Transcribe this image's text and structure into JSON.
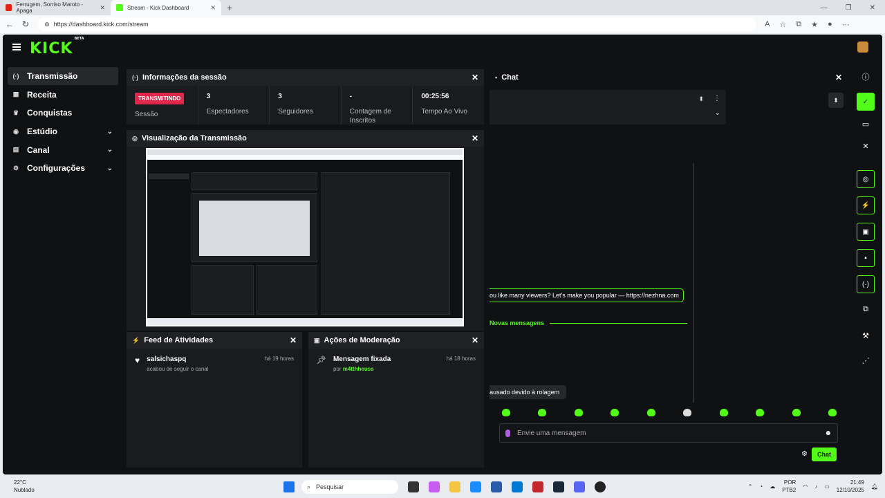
{
  "browser": {
    "tabs": [
      {
        "title": "Ferrugem, Sorriso Maroto - Apaga",
        "color": "#e62117"
      },
      {
        "title": "Stream - Kick Dashboard",
        "color": "#53fc18"
      }
    ],
    "url": "https://dashboard.kick.com/stream"
  },
  "app": {
    "logo": "KICK",
    "logo_badge": "BETA",
    "accent": "#53fc18"
  },
  "sidebar": {
    "items": [
      {
        "label": "Transmissão",
        "icon": "broadcast-icon",
        "expandable": false,
        "active": true
      },
      {
        "label": "Receita",
        "icon": "bar-chart-icon",
        "expandable": false
      },
      {
        "label": "Conquistas",
        "icon": "trophy-icon",
        "expandable": false
      },
      {
        "label": "Estúdio",
        "icon": "studio-icon",
        "expandable": true
      },
      {
        "label": "Canal",
        "icon": "channel-icon",
        "expandable": true
      },
      {
        "label": "Configurações",
        "icon": "gear-icon",
        "expandable": true
      }
    ]
  },
  "session": {
    "title": "Informações da sessão",
    "status_badge": "TRANSMITINDO",
    "status_label": "Sessão",
    "stats": [
      {
        "value": "3",
        "label": "Espectadores"
      },
      {
        "value": "3",
        "label": "Seguidores"
      },
      {
        "value": "-",
        "label": "Contagem de Inscritos"
      },
      {
        "value": "00:25:56",
        "label": "Tempo Ao Vivo"
      }
    ]
  },
  "preview": {
    "title": "Visualização da Transmissão"
  },
  "activity_feed": {
    "title": "Feed de Atividades",
    "items": [
      {
        "user": "salsichaspq",
        "action": "acabou de seguir o canal",
        "time": "há 19 horas"
      }
    ]
  },
  "moderation": {
    "title": "Ações de Moderação",
    "items": [
      {
        "title": "Mensagem fixada",
        "by_prefix": "por",
        "by_user": "m4tthheuss",
        "time": "há 18 horas"
      }
    ]
  },
  "chat": {
    "title": "Chat",
    "message": "ou like many viewers? Let's make you popular — https://nezhna.com",
    "new_messages": "Novas mensagens",
    "paused": "ausado devido à rolagem",
    "input_placeholder": "Envie uma mensagem",
    "send_label": "Chat"
  },
  "taskbar": {
    "temperature": "22°C",
    "weather": "Nublado",
    "search": "Pesquisar",
    "lang": "POR",
    "layout": "PTB2",
    "time": "21:49",
    "date": "12/10/2025",
    "notif_count": "1"
  }
}
